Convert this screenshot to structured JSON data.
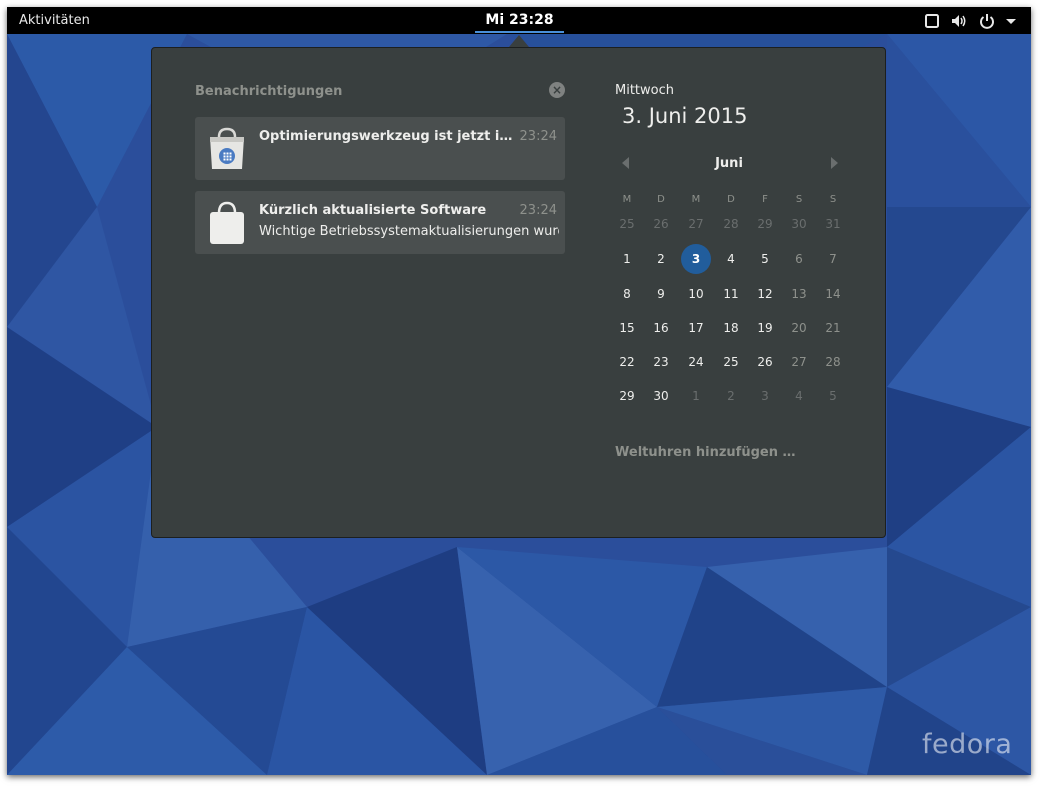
{
  "topbar": {
    "activities_label": "Aktivitäten",
    "clock_label": "Mi 23:28"
  },
  "notifications": {
    "header": "Benachrichtigungen",
    "items": [
      {
        "title": "Optimierungswerkzeug ist jetzt installiert",
        "time": "23:24",
        "body": "",
        "icon": "software-store-icon"
      },
      {
        "title": "Kürzlich aktualisierte Software",
        "time": "23:24",
        "body": "Wichtige Betriebssystemaktualisierungen wurden installiert",
        "icon": "software-bag-icon"
      }
    ]
  },
  "calendar": {
    "weekday": "Mittwoch",
    "date": "3. Juni 2015",
    "month": "Juni",
    "day_headers": [
      "M",
      "D",
      "M",
      "D",
      "F",
      "S",
      "S"
    ],
    "weeks": [
      [
        "25",
        "26",
        "27",
        "28",
        "29",
        "30",
        "31"
      ],
      [
        "1",
        "2",
        "3",
        "4",
        "5",
        "6",
        "7"
      ],
      [
        "8",
        "9",
        "10",
        "11",
        "12",
        "13",
        "14"
      ],
      [
        "15",
        "16",
        "17",
        "18",
        "19",
        "20",
        "21"
      ],
      [
        "22",
        "23",
        "24",
        "25",
        "26",
        "27",
        "28"
      ],
      [
        "29",
        "30",
        "1",
        "2",
        "3",
        "4",
        "5"
      ]
    ],
    "today": "3",
    "world_clocks_label": "Weltuhren hinzufügen …"
  },
  "branding": {
    "logo_text": "fedora"
  },
  "colors": {
    "accent": "#215d9c",
    "panel": "#393f3f",
    "wallpaper": "#2a4e9a"
  }
}
